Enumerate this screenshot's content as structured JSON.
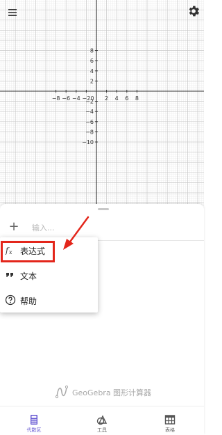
{
  "graph": {
    "x_ticks": [
      "−8",
      "−6",
      "−4",
      "−2",
      "0",
      "2",
      "4",
      "6",
      "8"
    ],
    "y_ticks": [
      "8",
      "6",
      "4",
      "2",
      "−2",
      "−4",
      "−6",
      "−8",
      "−10"
    ],
    "x_tick_values": [
      -8,
      -6,
      -4,
      -2,
      0,
      2,
      4,
      6,
      8
    ],
    "y_tick_values": [
      8,
      6,
      4,
      2,
      -2,
      -4,
      -6,
      -8,
      -10
    ]
  },
  "header": {
    "menu_icon": "hamburger-menu-icon",
    "settings_icon": "gear-icon"
  },
  "algebra": {
    "input_placeholder": "输入...",
    "add_icon": "plus-icon"
  },
  "dropdown": {
    "items": [
      {
        "label": "表达式",
        "icon": "fx-icon"
      },
      {
        "label": "文本",
        "icon": "quote-icon"
      },
      {
        "label": "帮助",
        "icon": "help-circle-icon"
      }
    ]
  },
  "annotation": {
    "highlight_color": "#e3261b",
    "arrow_color": "#e3261b"
  },
  "brand": {
    "text": "GeoGebra 图形计算器"
  },
  "nav": {
    "tabs": [
      {
        "label": "代数区",
        "icon": "calculator-icon",
        "active": true
      },
      {
        "label": "工具",
        "icon": "tools-icon",
        "active": false
      },
      {
        "label": "表格",
        "icon": "table-icon",
        "active": false
      }
    ]
  },
  "colors": {
    "accent": "#6557d2",
    "axis": "#333333",
    "grid_major": "#c9c9c9",
    "grid_minor": "#ececec"
  }
}
